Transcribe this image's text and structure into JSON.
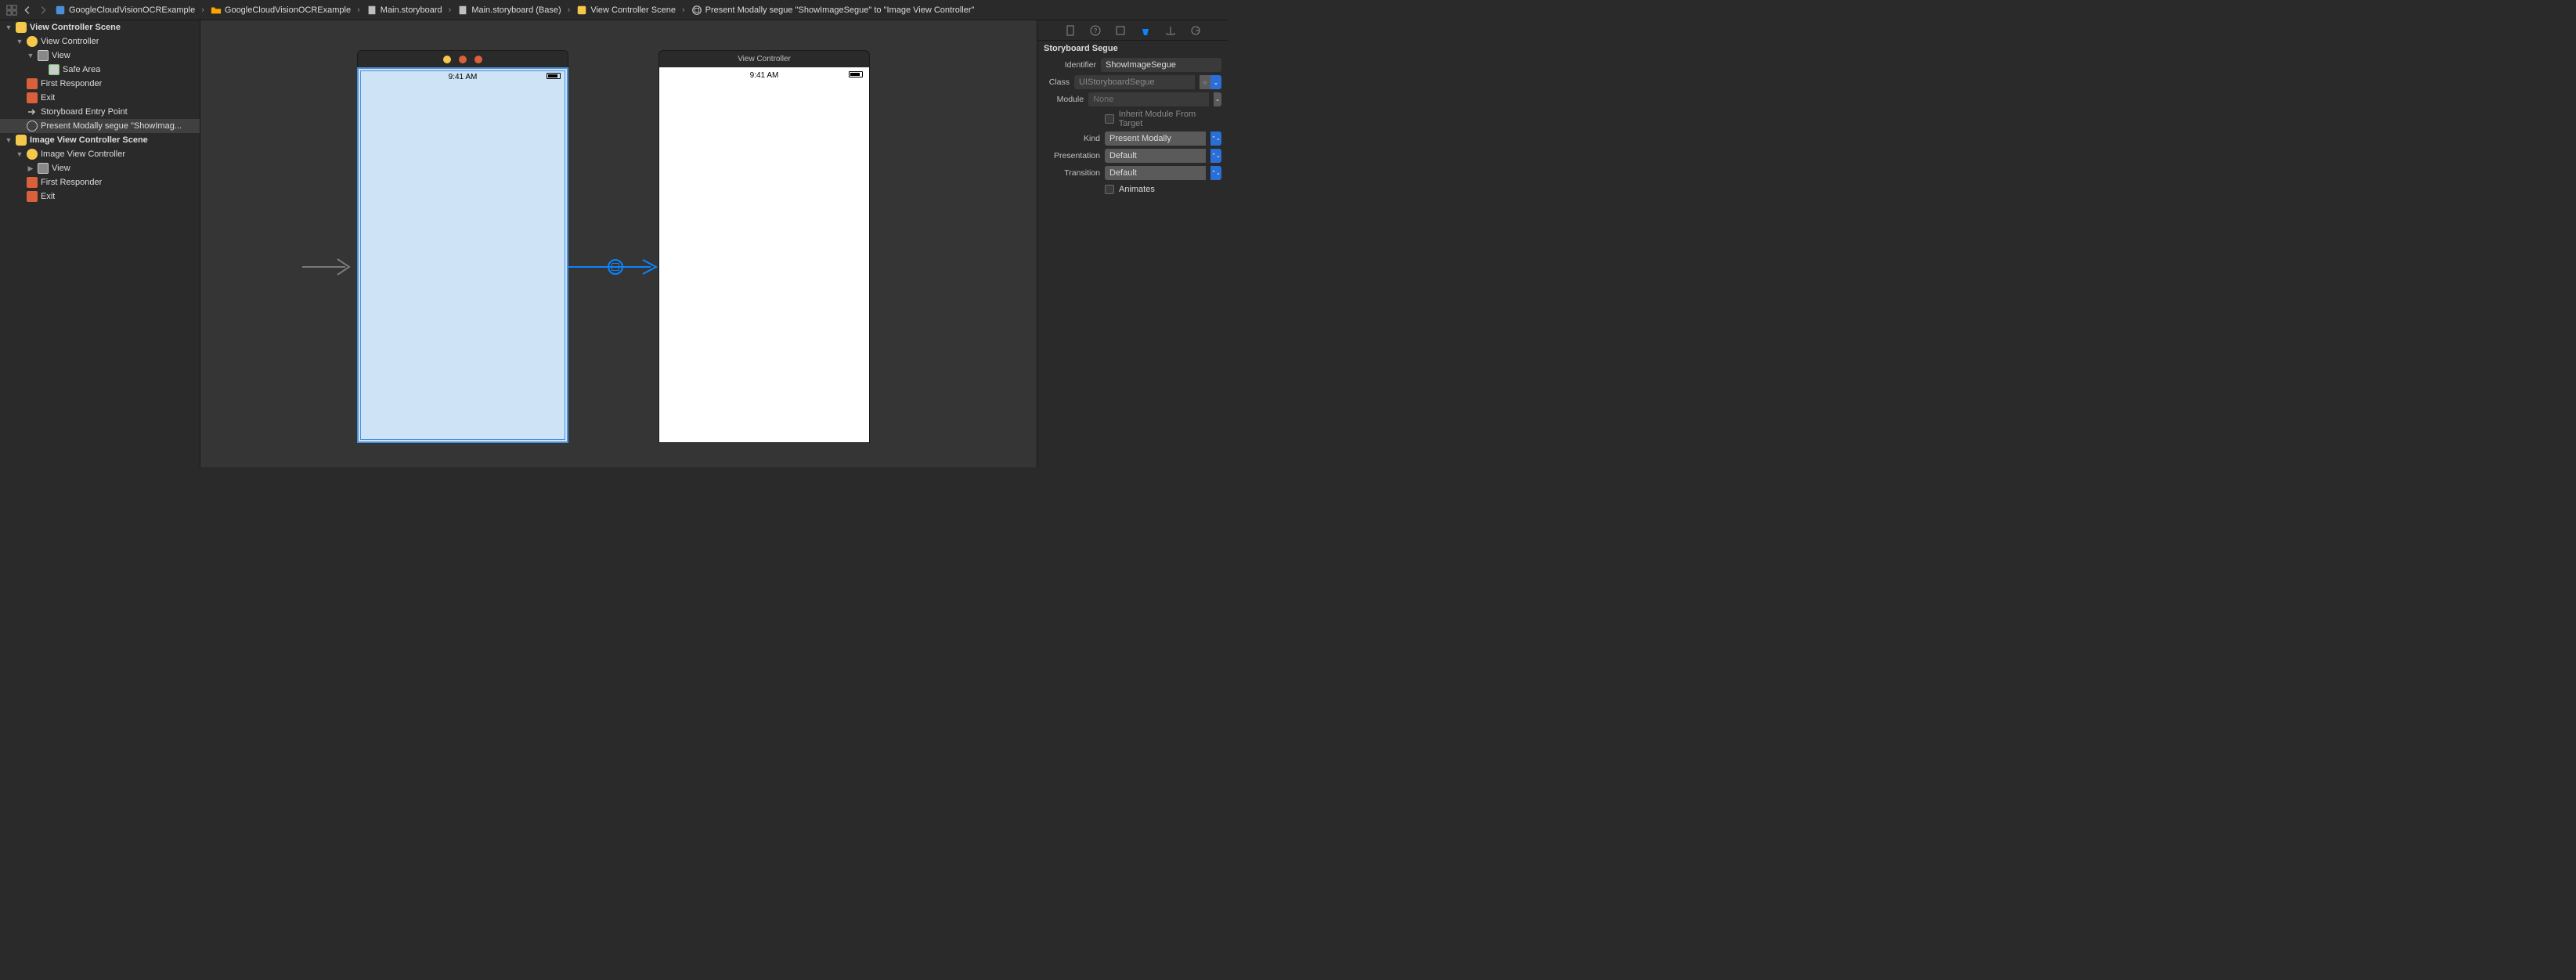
{
  "breadcrumb": {
    "items": [
      {
        "label": "GoogleCloudVisionOCRExample",
        "icon": "project"
      },
      {
        "label": "GoogleCloudVisionOCRExample",
        "icon": "folder"
      },
      {
        "label": "Main.storyboard",
        "icon": "storyboard"
      },
      {
        "label": "Main.storyboard (Base)",
        "icon": "storyboard"
      },
      {
        "label": "View Controller Scene",
        "icon": "scene"
      },
      {
        "label": "Present Modally segue \"ShowImageSegue\" to \"Image View Controller\"",
        "icon": "segue"
      }
    ]
  },
  "outline": {
    "scene1": {
      "title": "View Controller Scene",
      "vc": "View Controller",
      "view": "View",
      "safe": "Safe Area",
      "first": "First Responder",
      "exit": "Exit",
      "entry": "Storyboard Entry Point",
      "segue": "Present Modally segue \"ShowImag..."
    },
    "scene2": {
      "title": "Image View Controller Scene",
      "vc": "Image View Controller",
      "view": "View",
      "first": "First Responder",
      "exit": "Exit"
    }
  },
  "canvas": {
    "phone1": {
      "time": "9:41 AM"
    },
    "phone2": {
      "title": "View Controller",
      "time": "9:41 AM"
    }
  },
  "inspector": {
    "section_title": "Storyboard Segue",
    "identifier_label": "Identifier",
    "identifier_value": "ShowImageSegue",
    "class_label": "Class",
    "class_value": "UIStoryboardSegue",
    "module_label": "Module",
    "module_value": "None",
    "inherit_label": "Inherit Module From Target",
    "kind_label": "Kind",
    "kind_value": "Present Modally",
    "presentation_label": "Presentation",
    "presentation_value": "Default",
    "transition_label": "Transition",
    "transition_value": "Default",
    "animates_label": "Animates"
  }
}
